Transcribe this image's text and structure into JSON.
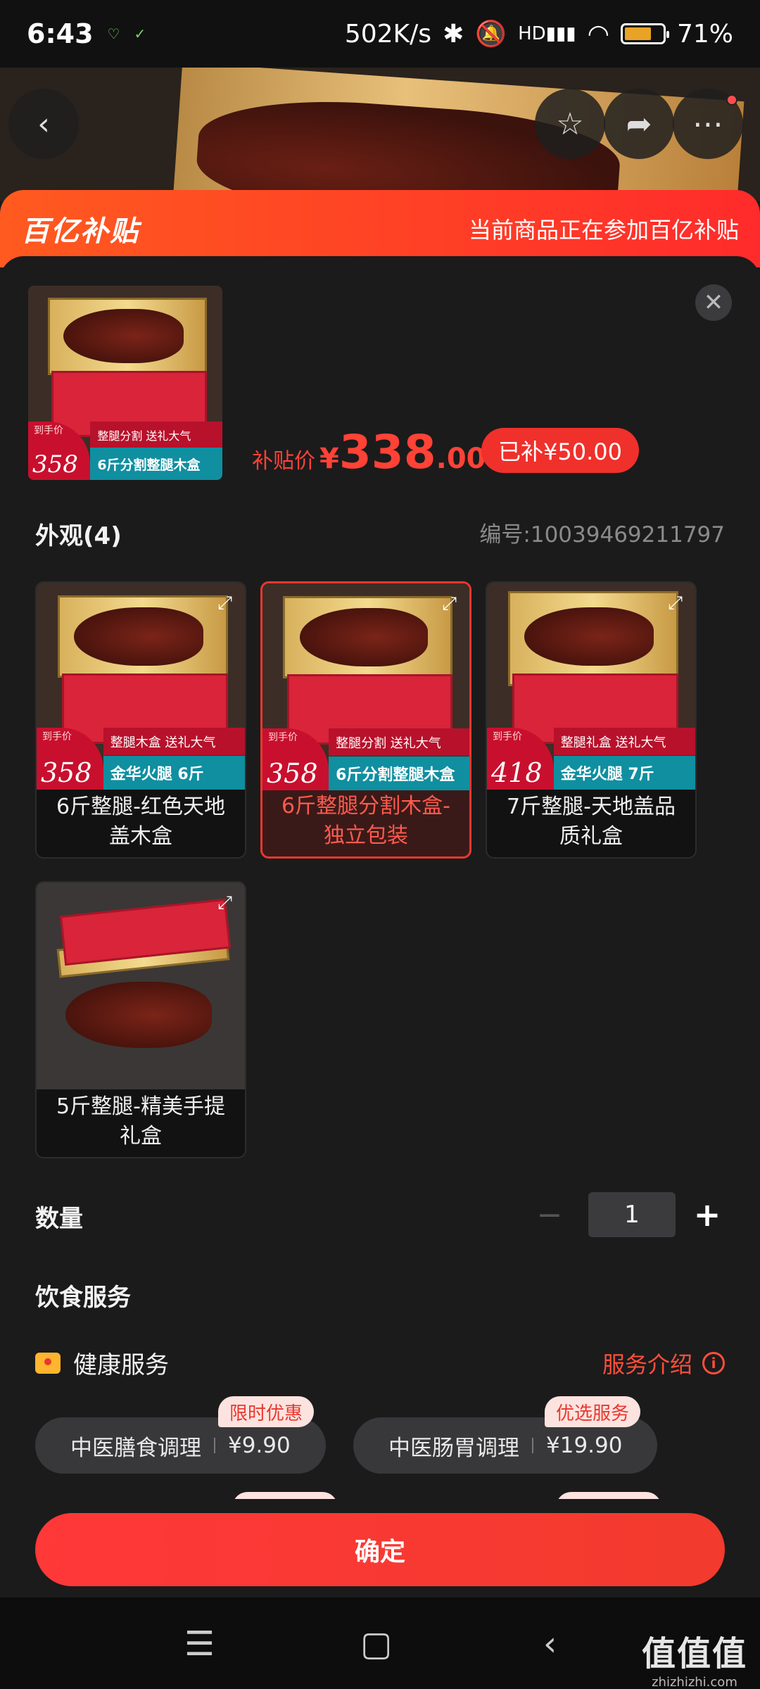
{
  "status_bar": {
    "time": "6:43",
    "net_speed": "502K/s",
    "battery_pct": "71%",
    "battery_level": 0.71,
    "icons": [
      "heart-status-icon",
      "vpn-status-icon",
      "bluetooth-icon",
      "mute-icon",
      "hd-signal-icon",
      "wifi-icon",
      "battery-icon"
    ]
  },
  "header": {
    "back_icon": "chevron-left-icon",
    "actions": [
      "star-icon",
      "share-icon",
      "more-icon"
    ]
  },
  "banner": {
    "logo_text": "百亿补贴",
    "message": "当前商品正在参加百亿补贴"
  },
  "product": {
    "thumb_tag": {
      "label": "到手价",
      "price": "358",
      "top": "整腿分割  送礼大气",
      "bottom": "6斤分割整腿木盒"
    },
    "price_label": "补贴价",
    "currency": "¥",
    "price_int": "338",
    "price_dec": ".00",
    "subsidy": "已补¥50.00",
    "sku_no": "编号:10039469211797"
  },
  "options_section": {
    "title": "外观(4)",
    "items": [
      {
        "caption": "6斤整腿-红色天地盖木盒",
        "tag_label": "到手价",
        "tag_price": "358",
        "tag_top": "整腿木盒  送礼大气",
        "tag_bottom": "金华火腿 6斤",
        "selected": false
      },
      {
        "caption": "6斤整腿分割木盒-独立包装",
        "tag_label": "到手价",
        "tag_price": "358",
        "tag_top": "整腿分割  送礼大气",
        "tag_bottom": "6斤分割整腿木盒",
        "selected": true
      },
      {
        "caption": "7斤整腿-天地盖品质礼盒",
        "tag_label": "到手价",
        "tag_price": "418",
        "tag_top": "整腿礼盒  送礼大气",
        "tag_bottom": "金华火腿 7斤",
        "selected": false
      },
      {
        "caption": "5斤整腿-精美手提礼盒",
        "selected": false
      }
    ]
  },
  "quantity": {
    "label": "数量",
    "value": "1",
    "minus": "−",
    "plus": "+"
  },
  "diet_service": {
    "title": "饮食服务",
    "health_label": "健康服务",
    "intro_label": "服务介绍",
    "chips": [
      {
        "name": "中医膳食调理",
        "price": "¥9.90",
        "badge": "限时优惠"
      },
      {
        "name": "中医肠胃调理",
        "price": "¥19.90",
        "badge": "优选服务"
      }
    ]
  },
  "confirm_label": "确定",
  "nav": {
    "icons": [
      "menu-icon",
      "home-icon",
      "back-icon"
    ]
  },
  "watermark": {
    "big": "值值值",
    "small": "zhizhizhi.com"
  }
}
